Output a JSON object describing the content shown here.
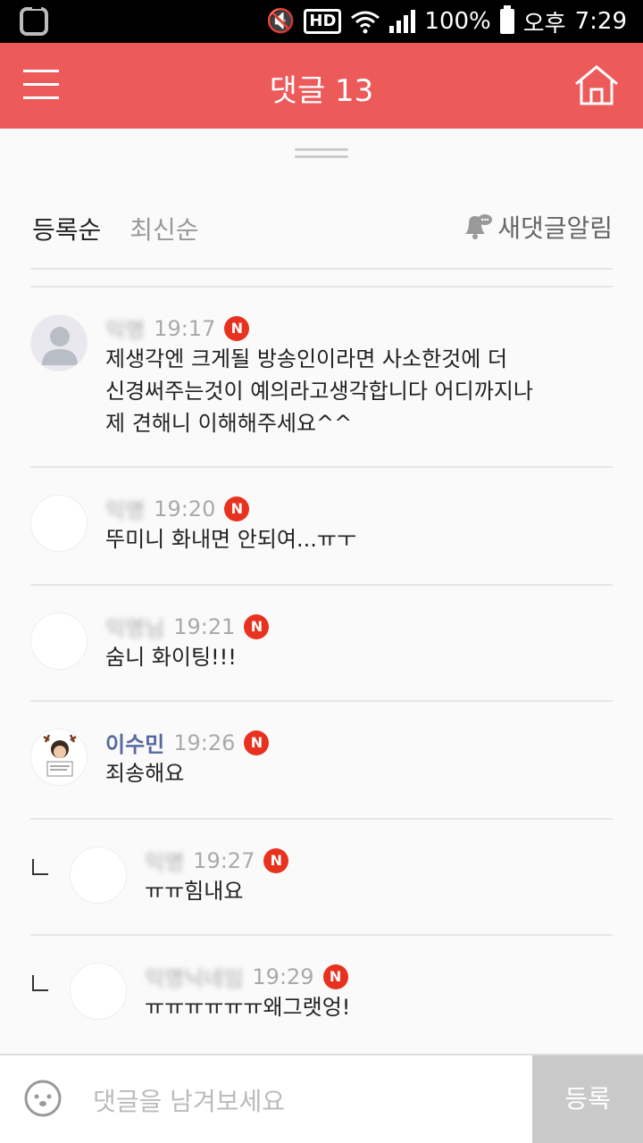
{
  "status_bar": {
    "battery": "100%",
    "ampm": "오후",
    "time": "7:29",
    "hd_label": "HD"
  },
  "header": {
    "title": "댓글 13"
  },
  "sort_tabs": [
    {
      "label": "등록순",
      "active": true
    },
    {
      "label": "최신순",
      "active": false
    }
  ],
  "notify_label": "새댓글알림",
  "badge_label": "N",
  "comments": [
    {
      "author": "익명",
      "time": "19:17",
      "text_lines": [
        "제생각엔 크게될 방송인이라면 사소한것에 더",
        "신경써주는것이 예의라고생각합니다 어디까지나",
        "제 견해니 이해해주세요^^"
      ]
    },
    {
      "author": "익명",
      "time": "19:20",
      "text_lines": [
        "뚜미니 화내면 안되여...ㅠㅜ"
      ]
    },
    {
      "author": "익명님",
      "time": "19:21",
      "text_lines": [
        "숨니 화이팅!!!"
      ]
    },
    {
      "author": "이수민",
      "time": "19:26",
      "text_lines": [
        "죄송해요"
      ]
    },
    {
      "author": "익명",
      "time": "19:27",
      "text_lines": [
        "ㅠㅠ힘내요"
      ],
      "reply": true
    },
    {
      "author": "익명닉네임",
      "time": "19:29",
      "text_lines": [
        "ㅠㅠㅠㅠㅠㅠ왜그랫엉!"
      ],
      "reply": true
    }
  ],
  "input": {
    "placeholder": "댓글을 남겨보세요",
    "submit_label": "등록"
  }
}
